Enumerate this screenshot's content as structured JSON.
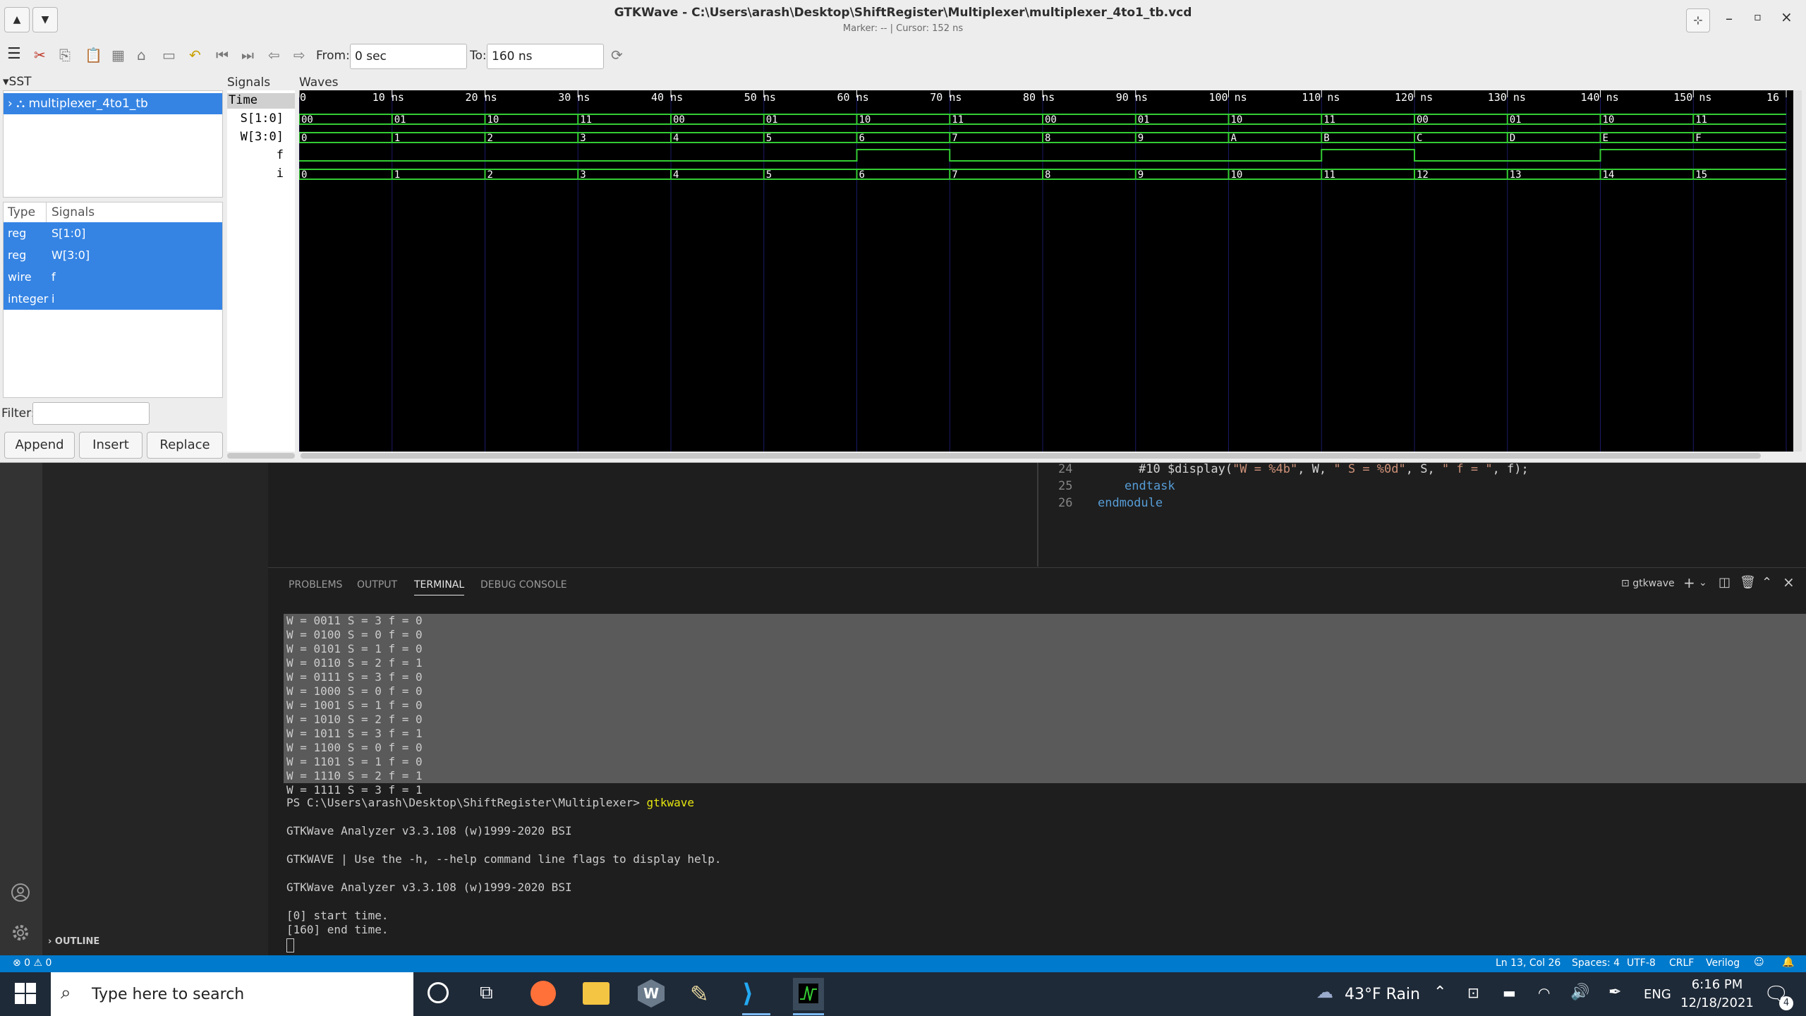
{
  "gtkwave": {
    "title": "GTKWave - C:\\Users\\arash\\Desktop\\ShiftRegister\\Multiplexer\\multiplexer_4to1_tb.vcd",
    "subtitle": "Marker: --  |  Cursor: 152 ns",
    "from_label": "From:",
    "from_value": "0 sec",
    "to_label": "To:",
    "to_value": "160 ns",
    "sst_label": "SST",
    "tree_item": "multiplexer_4to1_tb",
    "type_header": "Type",
    "signals_header": "Signals",
    "signal_list": [
      {
        "type": "reg",
        "name": "S[1:0]"
      },
      {
        "type": "reg",
        "name": "W[3:0]"
      },
      {
        "type": "wire",
        "name": "f"
      },
      {
        "type": "integer",
        "name": "i"
      }
    ],
    "filter_label": "Filter:",
    "filter_value": "",
    "append_label": "Append",
    "insert_label": "Insert",
    "replace_label": "Replace",
    "signals_pane_title": "Signals",
    "waves_pane_title": "Waves",
    "signal_names": [
      "Time",
      "S[1:0]",
      "W[3:0]",
      "f",
      "i"
    ],
    "timeline": {
      "labels": [
        "0",
        "10 ns",
        "20 ns",
        "30 ns",
        "40 ns",
        "50 ns",
        "60 ns",
        "70 ns",
        "80 ns",
        "90 ns",
        "100 ns",
        "110 ns",
        "120 ns",
        "130 ns",
        "140 ns",
        "150 ns",
        "16"
      ]
    },
    "waves": {
      "S": [
        "00",
        "01",
        "10",
        "11",
        "00",
        "01",
        "10",
        "11",
        "00",
        "01",
        "10",
        "11",
        "00",
        "01",
        "10",
        "11"
      ],
      "W": [
        "0",
        "1",
        "2",
        "3",
        "4",
        "5",
        "6",
        "7",
        "8",
        "9",
        "A",
        "B",
        "C",
        "D",
        "E",
        "F"
      ],
      "f": [
        0,
        0,
        0,
        0,
        0,
        0,
        1,
        0,
        0,
        0,
        0,
        1,
        0,
        0,
        1,
        1
      ],
      "i": [
        "0",
        "1",
        "2",
        "3",
        "4",
        "5",
        "6",
        "7",
        "8",
        "9",
        "10",
        "11",
        "12",
        "13",
        "14",
        "15"
      ]
    }
  },
  "editor": {
    "line_numbers": [
      "24",
      "25",
      "26"
    ],
    "line24_pre": "#10 $display(",
    "line24_s1": "\"W = %4b\"",
    "line24_mid1": ", W, ",
    "line24_s2": "\" S = %0d\"",
    "line24_mid2": ", S, ",
    "line24_s3": "\" f = \"",
    "line24_end": ", f);",
    "line25": "endtask",
    "line26": "endmodule"
  },
  "panel": {
    "tabs": [
      "PROBLEMS",
      "OUTPUT",
      "TERMINAL",
      "DEBUG CONSOLE"
    ],
    "active_tab": "TERMINAL",
    "shell_name": "gtkwave",
    "selected_lines": [
      "W = 0011 S = 3 f = 0",
      "W = 0100 S = 0 f = 0",
      "W = 0101 S = 1 f = 0",
      "W = 0110 S = 2 f = 1",
      "W = 0111 S = 3 f = 0",
      "W = 1000 S = 0 f = 0",
      "W = 1001 S = 1 f = 0",
      "W = 1010 S = 2 f = 0",
      "W = 1011 S = 3 f = 1",
      "W = 1100 S = 0 f = 0",
      "W = 1101 S = 1 f = 0",
      "W = 1110 S = 2 f = 1",
      "W = 1111 S = 3 f = 1"
    ],
    "prompt": "PS C:\\Users\\arash\\Desktop\\ShiftRegister\\Multiplexer> ",
    "command": "gtkwave",
    "output_lines": [
      "GTKWave Analyzer v3.3.108 (w)1999-2020 BSI",
      "",
      "GTKWAVE | Use the -h, --help command line flags to display help.",
      "",
      "GTKWave Analyzer v3.3.108 (w)1999-2020 BSI",
      "",
      "[0] start time.",
      "[160] end time."
    ]
  },
  "outline_label": "OUTLINE",
  "statusbar": {
    "problems": "⊗ 0 ⚠ 0",
    "position": "Ln 13, Col 26",
    "spaces": "Spaces: 4",
    "encoding": "UTF-8",
    "eol": "CRLF",
    "language": "Verilog"
  },
  "taskbar": {
    "search_placeholder": "Type here to search",
    "weather": "43°F  Rain",
    "lang": "ENG",
    "time": "6:16 PM",
    "date": "12/18/2021",
    "notif_count": "4"
  },
  "colors": {
    "wave_green": "#33cc33",
    "selection_blue": "#3584e4",
    "vscode_blue": "#007acc"
  }
}
